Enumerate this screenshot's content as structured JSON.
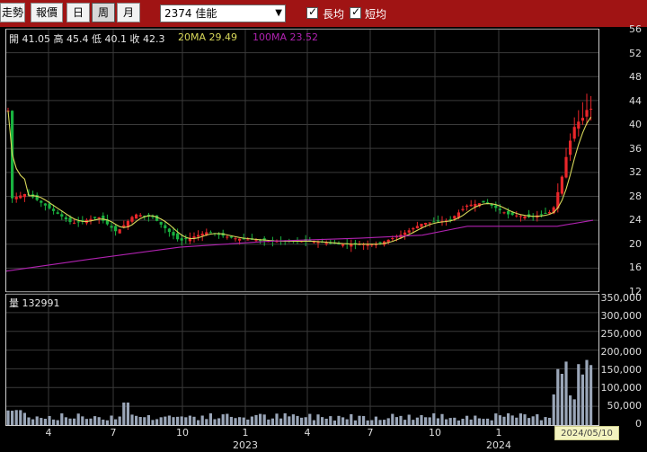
{
  "toolbar": {
    "buttons": [
      "走勢",
      "報價",
      "日",
      "周",
      "月"
    ],
    "active": "周",
    "symbol": "2374 佳能",
    "checks": [
      {
        "label": "長均",
        "checked": true
      },
      {
        "label": "短均",
        "checked": true
      }
    ]
  },
  "price_panel": {
    "ohlc": {
      "open_label": "開",
      "open": "41.05",
      "high_label": "高",
      "high": "45.4",
      "low_label": "低",
      "low": "40.1",
      "close_label": "收",
      "close": "42.3"
    },
    "ma20": {
      "label": "20MA",
      "value": "29.49",
      "color": "#d8d85a"
    },
    "ma100": {
      "label": "100MA",
      "value": "23.52",
      "color": "#b022b0"
    },
    "y_ticks": [
      "56",
      "52",
      "48",
      "44",
      "40",
      "36",
      "32",
      "28",
      "24",
      "20",
      "16",
      "12"
    ]
  },
  "volume_panel": {
    "label": "量",
    "value": "132991",
    "y_ticks": [
      "350,000",
      "300,000",
      "250,000",
      "200,000",
      "150,000",
      "100,000",
      "50,000",
      "0"
    ]
  },
  "x_ticks": [
    "4",
    "7",
    "10",
    "1",
    "4",
    "7",
    "10",
    "1"
  ],
  "x_years": [
    "2023",
    "2024"
  ],
  "cursor_date": "2024/05/10",
  "colors": {
    "up": "#e8262a",
    "down": "#19b23f",
    "bg": "#000000",
    "grid": "#3a3a3a",
    "toolbar": "#a01414",
    "volume": "#9aa6b8"
  },
  "chart_data": {
    "type": "candlestick",
    "interval": "weekly",
    "ylim": [
      12,
      56
    ],
    "volume_ylim": [
      0,
      350000
    ],
    "last_bar": {
      "date": "2024/05/10",
      "open": 41.05,
      "high": 45.4,
      "low": 40.1,
      "close": 42.3,
      "volume": 132991
    },
    "ma20_last": 29.49,
    "ma100_last": 23.52
  }
}
